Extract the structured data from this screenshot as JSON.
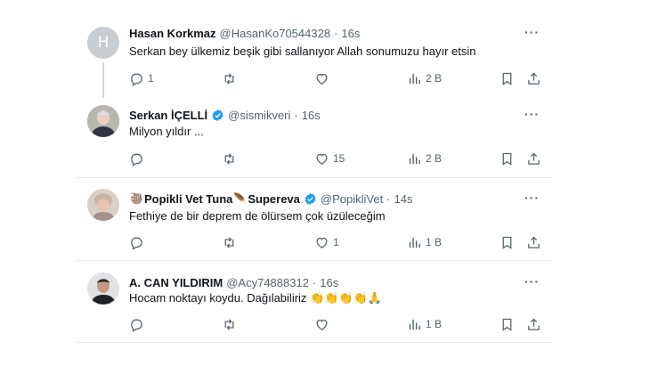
{
  "tweets": [
    {
      "name": "Hasan Korkmaz",
      "handle": "@HasanKo70544328",
      "time": "16s",
      "text": "Serkan bey ülkemiz beşik gibi sallanıyor Allah sonumuzu hayır etsin",
      "avatar_letter": "H",
      "reply_count": "1",
      "retweet_count": "",
      "like_count": "",
      "views": "2 B"
    },
    {
      "name": "Serkan İÇELLİ",
      "handle": "@sismikveri",
      "time": "16s",
      "text": "Milyon yıldır ...",
      "verified": true,
      "reply_count": "",
      "retweet_count": "",
      "like_count": "15",
      "views": "2 B"
    },
    {
      "name_prefix_emoji": "🦥",
      "name": "Popikli Vet Tuna",
      "name_mid_emoji": "🪶",
      "name_suffix": "Supereva",
      "handle": "@PopikliVet",
      "time": "14s",
      "text": "Fethiye de bir deprem de ölürsem çok üzüleceğim",
      "verified": true,
      "reply_count": "",
      "retweet_count": "",
      "like_count": "1",
      "views": "1 B"
    },
    {
      "name": "A. CAN YILDIRIM",
      "handle": "@Acy74888312",
      "time": "16s",
      "text": "Hocam noktayı koydu. Dağılabiliriz",
      "text_emojis": "👏👏👏👏🙏",
      "reply_count": "",
      "retweet_count": "",
      "like_count": "",
      "views": "1 B"
    }
  ],
  "ui": {
    "separator": "·",
    "more": "···"
  },
  "colors": {
    "text_primary": "#0f1419",
    "text_secondary": "#536471",
    "verified_blue": "#1d9bf0",
    "divider": "#e3e6e9",
    "thread_line": "#cfd9de"
  },
  "icons": [
    "reply-icon",
    "retweet-icon",
    "like-icon",
    "views-icon",
    "bookmark-icon",
    "share-icon",
    "more-icon",
    "verified-badge-icon"
  ]
}
